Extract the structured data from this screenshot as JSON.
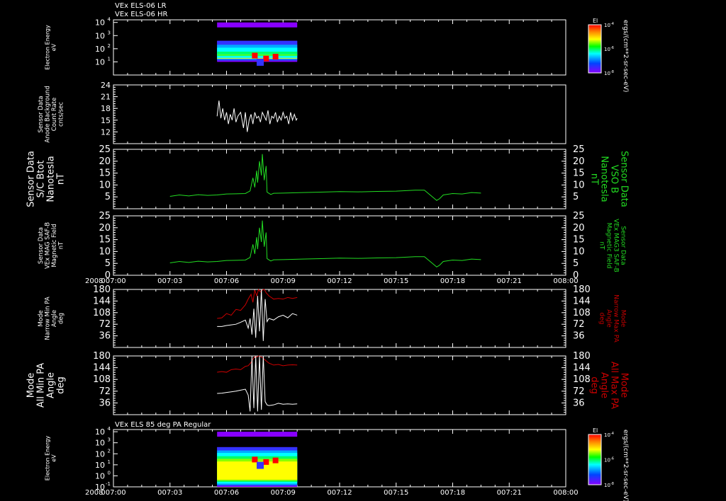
{
  "colors": {
    "white": "#ffffff",
    "green": "#22dd22",
    "red": "#cc0000"
  },
  "header": {
    "line1": "VEx ELS-06 LR",
    "line2": "VEx ELS-06 HR"
  },
  "footer_title": "VEx ELS 85 deg PA Regular",
  "time_axis": {
    "year": "2008",
    "ticks": [
      "007:00",
      "007:03",
      "007:06",
      "007:09",
      "007:12",
      "007:15",
      "007:18",
      "007:21",
      "008:00"
    ]
  },
  "panels": [
    {
      "id": "els-hr",
      "left_label": [
        "Electron Energy",
        "eV"
      ],
      "right_label": [],
      "ticks_left": [
        "10",
        "10",
        "10",
        "10"
      ],
      "tick_exps": [
        "4",
        "3",
        "2",
        "1"
      ],
      "tick_vals": [
        4,
        3,
        2,
        1
      ],
      "scale": "log",
      "range": [
        0,
        4.2
      ],
      "colorbar": {
        "title": "El",
        "unit": "ergs/(cm**2-sr-sec-eV)",
        "labels": [
          "10",
          "10",
          "10"
        ],
        "label_exps": [
          "-4",
          "-6",
          "-8"
        ]
      }
    },
    {
      "id": "anode-bg",
      "left_label": [
        "Sensor Data",
        "Anode Background",
        "Count Rate",
        "cnts/sec"
      ],
      "right_label": [],
      "ticks_left": [
        "24",
        "21",
        "18",
        "15",
        "12"
      ],
      "tick_vals": [
        24,
        21,
        18,
        15,
        12
      ],
      "scale": "linear",
      "range": [
        9,
        24
      ]
    },
    {
      "id": "btot",
      "left_label": [
        "Sensor Data",
        "S/C Btot",
        "Nanotesla",
        "nT"
      ],
      "right_label": [
        "Sensor Data",
        "VSO B",
        "Nanotesla",
        "nT"
      ],
      "ticks_left": [
        "25",
        "20",
        "15",
        "10",
        "5"
      ],
      "tick_vals": [
        25,
        20,
        15,
        10,
        5
      ],
      "scale": "linear",
      "range": [
        0,
        25
      ]
    },
    {
      "id": "saf-b",
      "left_label": [
        "Sensor Data",
        "VEx MAG SAF-B",
        "Magnetic Field",
        "nT"
      ],
      "right_label": [
        "Sensor Data",
        "VEx MAG3 SAF-B",
        "Magnetic Field",
        "nT"
      ],
      "ticks_left": [
        "25",
        "20",
        "15",
        "10",
        "5",
        "0"
      ],
      "tick_vals": [
        25,
        20,
        15,
        10,
        5,
        0
      ],
      "scale": "linear",
      "range": [
        0,
        25
      ]
    },
    {
      "id": "narrow-pa",
      "left_label": [
        "Mode",
        "Narrow Min PA",
        "Angle",
        "deg"
      ],
      "right_label": [
        "Mode",
        "Narrow Max PA",
        "Angle",
        "deg"
      ],
      "ticks_left": [
        "180",
        "144",
        "108",
        "72",
        "36"
      ],
      "tick_vals": [
        180,
        144,
        108,
        72,
        36
      ],
      "scale": "linear",
      "range": [
        0,
        180
      ]
    },
    {
      "id": "all-pa",
      "left_label": [
        "Mode",
        "All Min PA",
        "Angle",
        "deg"
      ],
      "right_label": [
        "Mode",
        "All Max PA",
        "Angle",
        "deg"
      ],
      "ticks_left": [
        "180",
        "144",
        "108",
        "72",
        "36"
      ],
      "tick_vals": [
        180,
        144,
        108,
        72,
        36
      ],
      "scale": "linear",
      "range": [
        0,
        180
      ]
    },
    {
      "id": "els-85",
      "left_label": [
        "Electron Energy",
        "eV"
      ],
      "right_label": [],
      "ticks_left": [
        "10",
        "10",
        "10",
        "10",
        "10",
        "10"
      ],
      "tick_exps": [
        "4",
        "3",
        "2",
        "1",
        "0",
        "-1"
      ],
      "tick_vals": [
        4,
        3,
        2,
        1,
        0,
        -1
      ],
      "scale": "log",
      "range": [
        -1,
        4.2
      ],
      "colorbar": {
        "title": "El",
        "unit": "ergs/(cm**2-sr-sec-eV)",
        "labels": [
          "10",
          "10",
          "10"
        ],
        "label_exps": [
          "-4",
          "-6",
          "-8"
        ]
      }
    }
  ],
  "chart_data": [
    {
      "type": "heatmap",
      "panel": "els-hr",
      "x_range_min": [
        110,
        195
      ],
      "energy_eV": [
        10,
        10000
      ],
      "note_cmap": "rainbow"
    },
    {
      "type": "line",
      "panel": "anode-bg",
      "x": [
        110,
        112,
        114,
        116,
        118,
        120,
        122,
        124,
        126,
        128,
        130,
        132,
        135,
        138,
        140,
        142,
        144,
        146,
        148,
        150,
        152,
        154,
        156,
        158,
        160,
        162,
        164,
        166,
        168,
        170,
        172,
        174,
        176,
        178,
        180,
        182,
        184,
        186,
        188,
        190,
        192,
        194,
        195
      ],
      "y": [
        16,
        20,
        15.5,
        18,
        15,
        17,
        14,
        16.5,
        15,
        18,
        14.5,
        16,
        17,
        13,
        17,
        12,
        15,
        16.5,
        14,
        17,
        15.5,
        16,
        14.5,
        17,
        16,
        15,
        17.5,
        14,
        16,
        15.5,
        17,
        14.5,
        16,
        15,
        17,
        15.5,
        16,
        14,
        17,
        15,
        16.5,
        15,
        15.5
      ]
    },
    {
      "type": "line",
      "panel": "btot",
      "x": [
        60,
        70,
        80,
        90,
        100,
        110,
        120,
        130,
        140,
        145,
        148,
        150,
        152,
        153,
        155,
        157,
        158,
        160,
        162,
        163,
        165,
        167,
        170,
        180,
        200,
        220,
        240,
        260,
        280,
        300,
        320,
        330,
        340,
        343,
        346,
        350,
        360,
        370,
        380,
        390
      ],
      "y": [
        5.2,
        5.8,
        5.4,
        5.9,
        5.6,
        5.8,
        6.2,
        6.3,
        6.4,
        7.5,
        13,
        9,
        16,
        11,
        20,
        14,
        23,
        12,
        18,
        7,
        6.5,
        6,
        6.5,
        6.6,
        6.8,
        7,
        7.2,
        7.1,
        7.3,
        7.4,
        7.8,
        7.8,
        4.5,
        3.5,
        4.2,
        5.8,
        6.4,
        6.2,
        6.8,
        6.6
      ]
    },
    {
      "type": "line",
      "panel": "saf-b",
      "x": [
        60,
        70,
        80,
        90,
        100,
        110,
        120,
        130,
        140,
        145,
        148,
        150,
        152,
        153,
        155,
        157,
        158,
        160,
        162,
        163,
        165,
        167,
        170,
        180,
        200,
        220,
        240,
        260,
        280,
        300,
        320,
        330,
        340,
        343,
        346,
        350,
        360,
        370,
        380,
        390
      ],
      "y": [
        5.2,
        5.8,
        5.4,
        5.9,
        5.6,
        5.8,
        6.2,
        6.3,
        6.4,
        7.5,
        13,
        9,
        16,
        11,
        20,
        14,
        23,
        12,
        18,
        7,
        6.5,
        6,
        6.5,
        6.6,
        6.8,
        7,
        7.2,
        7.1,
        7.3,
        7.4,
        7.8,
        7.8,
        4.5,
        3.5,
        4.2,
        5.8,
        6.4,
        6.2,
        6.8,
        6.6
      ]
    },
    {
      "type": "line",
      "panel": "narrow-pa",
      "series": [
        {
          "name": "Narrow Max PA",
          "color": "red",
          "x": [
            110,
            115,
            120,
            125,
            130,
            135,
            140,
            143,
            146,
            148,
            150,
            152,
            154,
            156,
            158,
            160,
            162,
            165,
            170,
            175,
            180,
            185,
            190,
            195
          ],
          "y": [
            90,
            92,
            105,
            100,
            118,
            115,
            132,
            150,
            165,
            140,
            178,
            160,
            180,
            172,
            178,
            180,
            170,
            160,
            150,
            152,
            150,
            155,
            152,
            155
          ]
        },
        {
          "name": "Narrow Min PA",
          "color": "white",
          "x": [
            110,
            115,
            120,
            125,
            130,
            135,
            140,
            143,
            145,
            147,
            149,
            151,
            153,
            155,
            157,
            159,
            161,
            163,
            165,
            170,
            175,
            180,
            185,
            190,
            195
          ],
          "y": [
            65,
            65,
            68,
            70,
            72,
            78,
            85,
            60,
            90,
            40,
            120,
            30,
            160,
            50,
            180,
            20,
            150,
            80,
            90,
            85,
            95,
            100,
            92,
            105,
            100
          ]
        }
      ]
    },
    {
      "type": "line",
      "panel": "all-pa",
      "series": [
        {
          "name": "All Max PA",
          "color": "red",
          "x": [
            110,
            115,
            120,
            125,
            130,
            135,
            140,
            143,
            146,
            148,
            150,
            152,
            154,
            156,
            158,
            160,
            162,
            165,
            170,
            175,
            180,
            185,
            190,
            195
          ],
          "y": [
            130,
            132,
            130,
            138,
            140,
            138,
            148,
            150,
            160,
            170,
            178,
            176,
            180,
            178,
            175,
            170,
            165,
            158,
            152,
            154,
            150,
            152,
            153,
            152
          ]
        },
        {
          "name": "All Min PA",
          "color": "white",
          "x": [
            110,
            115,
            120,
            125,
            130,
            135,
            140,
            143,
            145,
            147,
            149,
            151,
            153,
            155,
            157,
            159,
            161,
            163,
            165,
            170,
            175,
            180,
            185,
            190,
            195
          ],
          "y": [
            65,
            66,
            68,
            70,
            72,
            75,
            78,
            60,
            10,
            180,
            20,
            180,
            10,
            180,
            15,
            180,
            40,
            30,
            28,
            30,
            35,
            32,
            33,
            32,
            33
          ]
        }
      ]
    },
    {
      "type": "heatmap",
      "panel": "els-85",
      "x_range_min": [
        110,
        195
      ],
      "energy_eV": [
        0.1,
        10000
      ],
      "note_cmap": "rainbow"
    }
  ]
}
